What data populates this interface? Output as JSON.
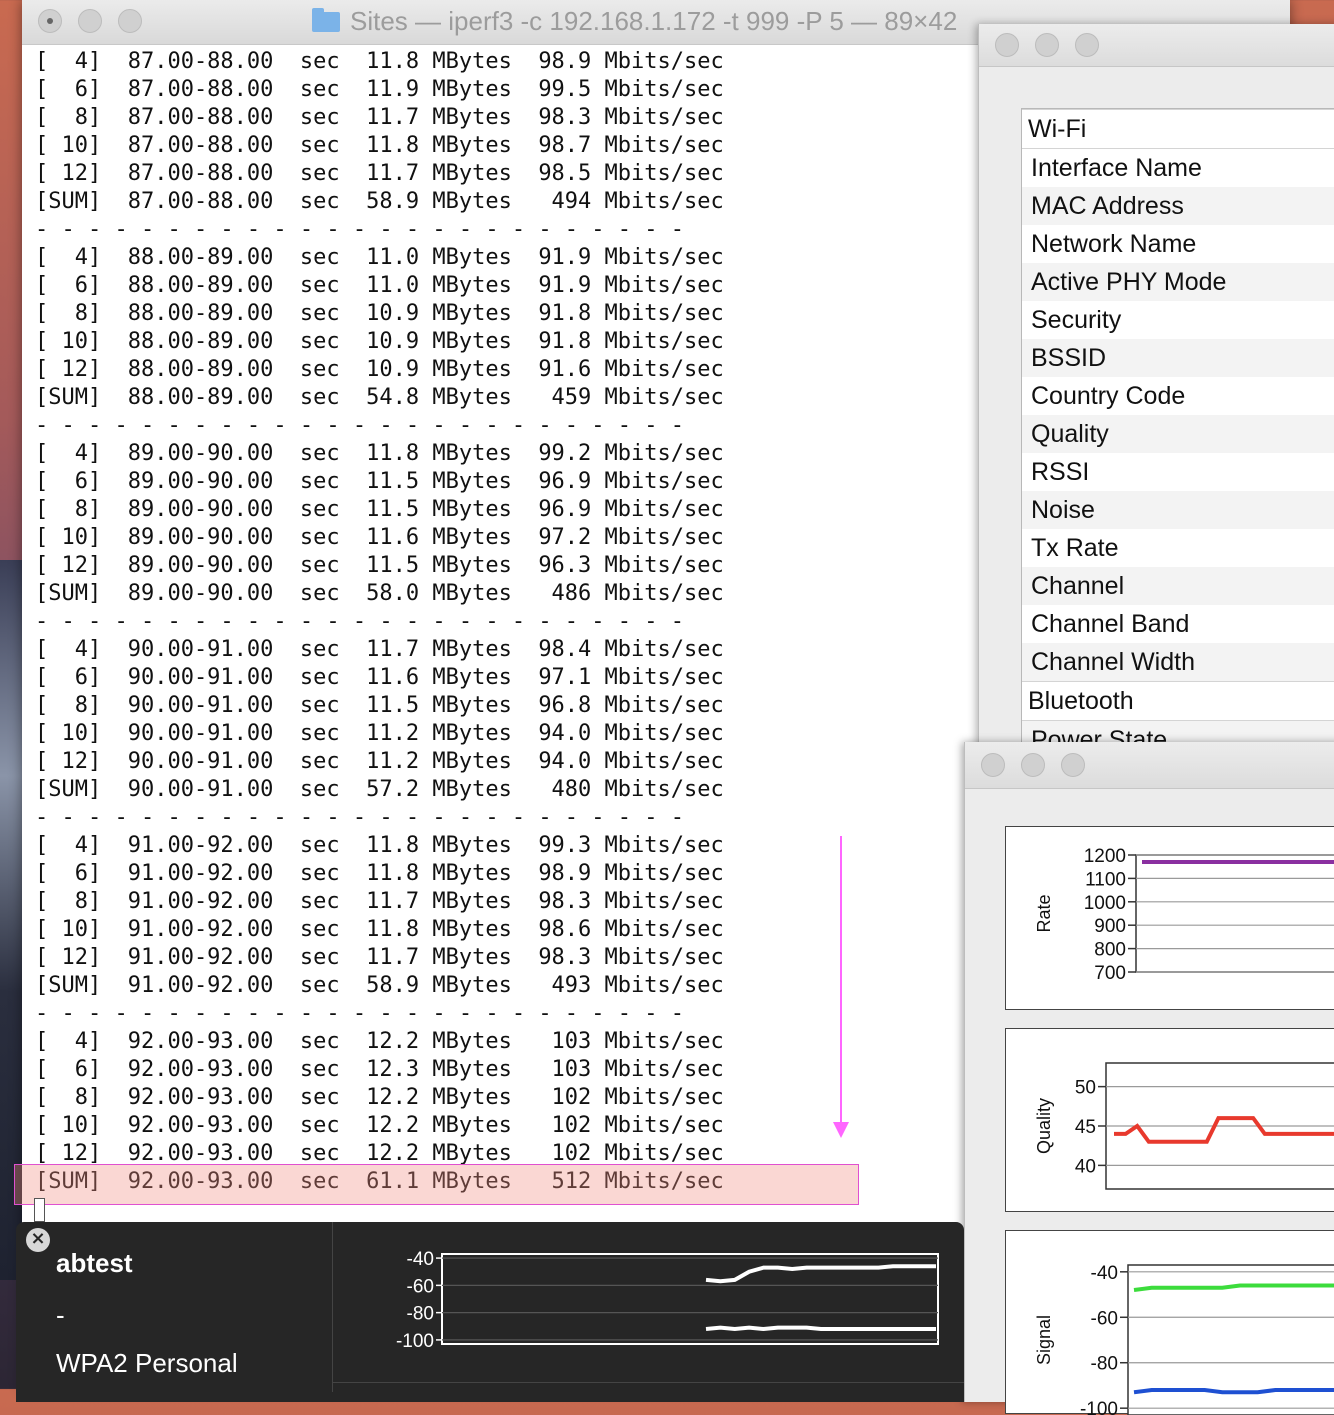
{
  "terminal": {
    "title": "Sites — iperf3 -c 192.168.1.172 -t 999 -P 5 — 89×42",
    "lines": [
      "[  4]  87.00-88.00  sec  11.8 MBytes  98.9 Mbits/sec",
      "[  6]  87.00-88.00  sec  11.9 MBytes  99.5 Mbits/sec",
      "[  8]  87.00-88.00  sec  11.7 MBytes  98.3 Mbits/sec",
      "[ 10]  87.00-88.00  sec  11.8 MBytes  98.7 Mbits/sec",
      "[ 12]  87.00-88.00  sec  11.7 MBytes  98.5 Mbits/sec",
      "[SUM]  87.00-88.00  sec  58.9 MBytes   494 Mbits/sec",
      "- - - - - - - - - - - - - - - - - - - - - - - - -",
      "[  4]  88.00-89.00  sec  11.0 MBytes  91.9 Mbits/sec",
      "[  6]  88.00-89.00  sec  11.0 MBytes  91.9 Mbits/sec",
      "[  8]  88.00-89.00  sec  10.9 MBytes  91.8 Mbits/sec",
      "[ 10]  88.00-89.00  sec  10.9 MBytes  91.8 Mbits/sec",
      "[ 12]  88.00-89.00  sec  10.9 MBytes  91.6 Mbits/sec",
      "[SUM]  88.00-89.00  sec  54.8 MBytes   459 Mbits/sec",
      "- - - - - - - - - - - - - - - - - - - - - - - - -",
      "[  4]  89.00-90.00  sec  11.8 MBytes  99.2 Mbits/sec",
      "[  6]  89.00-90.00  sec  11.5 MBytes  96.9 Mbits/sec",
      "[  8]  89.00-90.00  sec  11.5 MBytes  96.9 Mbits/sec",
      "[ 10]  89.00-90.00  sec  11.6 MBytes  97.2 Mbits/sec",
      "[ 12]  89.00-90.00  sec  11.5 MBytes  96.3 Mbits/sec",
      "[SUM]  89.00-90.00  sec  58.0 MBytes   486 Mbits/sec",
      "- - - - - - - - - - - - - - - - - - - - - - - - -",
      "[  4]  90.00-91.00  sec  11.7 MBytes  98.4 Mbits/sec",
      "[  6]  90.00-91.00  sec  11.6 MBytes  97.1 Mbits/sec",
      "[  8]  90.00-91.00  sec  11.5 MBytes  96.8 Mbits/sec",
      "[ 10]  90.00-91.00  sec  11.2 MBytes  94.0 Mbits/sec",
      "[ 12]  90.00-91.00  sec  11.2 MBytes  94.0 Mbits/sec",
      "[SUM]  90.00-91.00  sec  57.2 MBytes   480 Mbits/sec",
      "- - - - - - - - - - - - - - - - - - - - - - - - -",
      "[  4]  91.00-92.00  sec  11.8 MBytes  99.3 Mbits/sec",
      "[  6]  91.00-92.00  sec  11.8 MBytes  98.9 Mbits/sec",
      "[  8]  91.00-92.00  sec  11.7 MBytes  98.3 Mbits/sec",
      "[ 10]  91.00-92.00  sec  11.8 MBytes  98.6 Mbits/sec",
      "[ 12]  91.00-92.00  sec  11.7 MBytes  98.3 Mbits/sec",
      "[SUM]  91.00-92.00  sec  58.9 MBytes   493 Mbits/sec",
      "- - - - - - - - - - - - - - - - - - - - - - - - -",
      "[  4]  92.00-93.00  sec  12.2 MBytes   103 Mbits/sec",
      "[  6]  92.00-93.00  sec  12.3 MBytes   103 Mbits/sec",
      "[  8]  92.00-93.00  sec  12.2 MBytes   102 Mbits/sec",
      "[ 10]  92.00-93.00  sec  12.2 MBytes   102 Mbits/sec",
      "[ 12]  92.00-93.00  sec  12.2 MBytes   102 Mbits/sec",
      "[SUM]  92.00-93.00  sec  61.1 MBytes   512 Mbits/sec"
    ]
  },
  "info": {
    "rows": [
      "Wi-Fi",
      "Interface Name",
      "MAC Address",
      "Network Name",
      "Active PHY Mode",
      "Security",
      "BSSID",
      "Country Code",
      "Quality",
      "RSSI",
      "Noise",
      "Tx Rate",
      "Channel",
      "Channel Band",
      "Channel Width",
      "Bluetooth",
      "Power State"
    ]
  },
  "graphs": {
    "rate": {
      "label": "Rate",
      "ticks": [
        "1200",
        "1100",
        "1000",
        "900",
        "800",
        "700"
      ],
      "line_color": "#8a2fa0"
    },
    "quality": {
      "label": "Quality",
      "ticks": [
        "50",
        "45",
        "40"
      ],
      "line_color": "#e8392d",
      "values": [
        44,
        44,
        45,
        43,
        43,
        43,
        43,
        43,
        43,
        46,
        46,
        46,
        46,
        44,
        44,
        44,
        44,
        44,
        44,
        44,
        44
      ]
    },
    "signal": {
      "label": "Signal",
      "ticks": [
        "-40",
        "-60",
        "-80",
        "-100"
      ],
      "rssi_color": "#3cdc3c",
      "noise_color": "#1e50d2",
      "rssi": [
        -48,
        -47,
        -47,
        -47,
        -47,
        -47,
        -46,
        -46,
        -46,
        -46,
        -46,
        -46,
        -46
      ],
      "noise": [
        -93,
        -92,
        -92,
        -92,
        -92,
        -93,
        -93,
        -93,
        -92,
        -92,
        -92,
        -92,
        -92
      ]
    }
  },
  "hud": {
    "network": "abtest",
    "dash": "-",
    "security": "WPA2 Personal",
    "ticks": [
      "-40",
      "-60",
      "-80",
      "-100"
    ],
    "rssi": [
      -56,
      -57,
      -56,
      -50,
      -47,
      -47,
      -48,
      -47,
      -47,
      -47,
      -47,
      -47,
      -47,
      -46,
      -46,
      -46,
      -46
    ],
    "noise": [
      -92,
      -91,
      -92,
      -91,
      -92,
      -91,
      -91,
      -91,
      -92,
      -92,
      -92,
      -92,
      -92,
      -92,
      -92,
      -92,
      -92
    ]
  }
}
